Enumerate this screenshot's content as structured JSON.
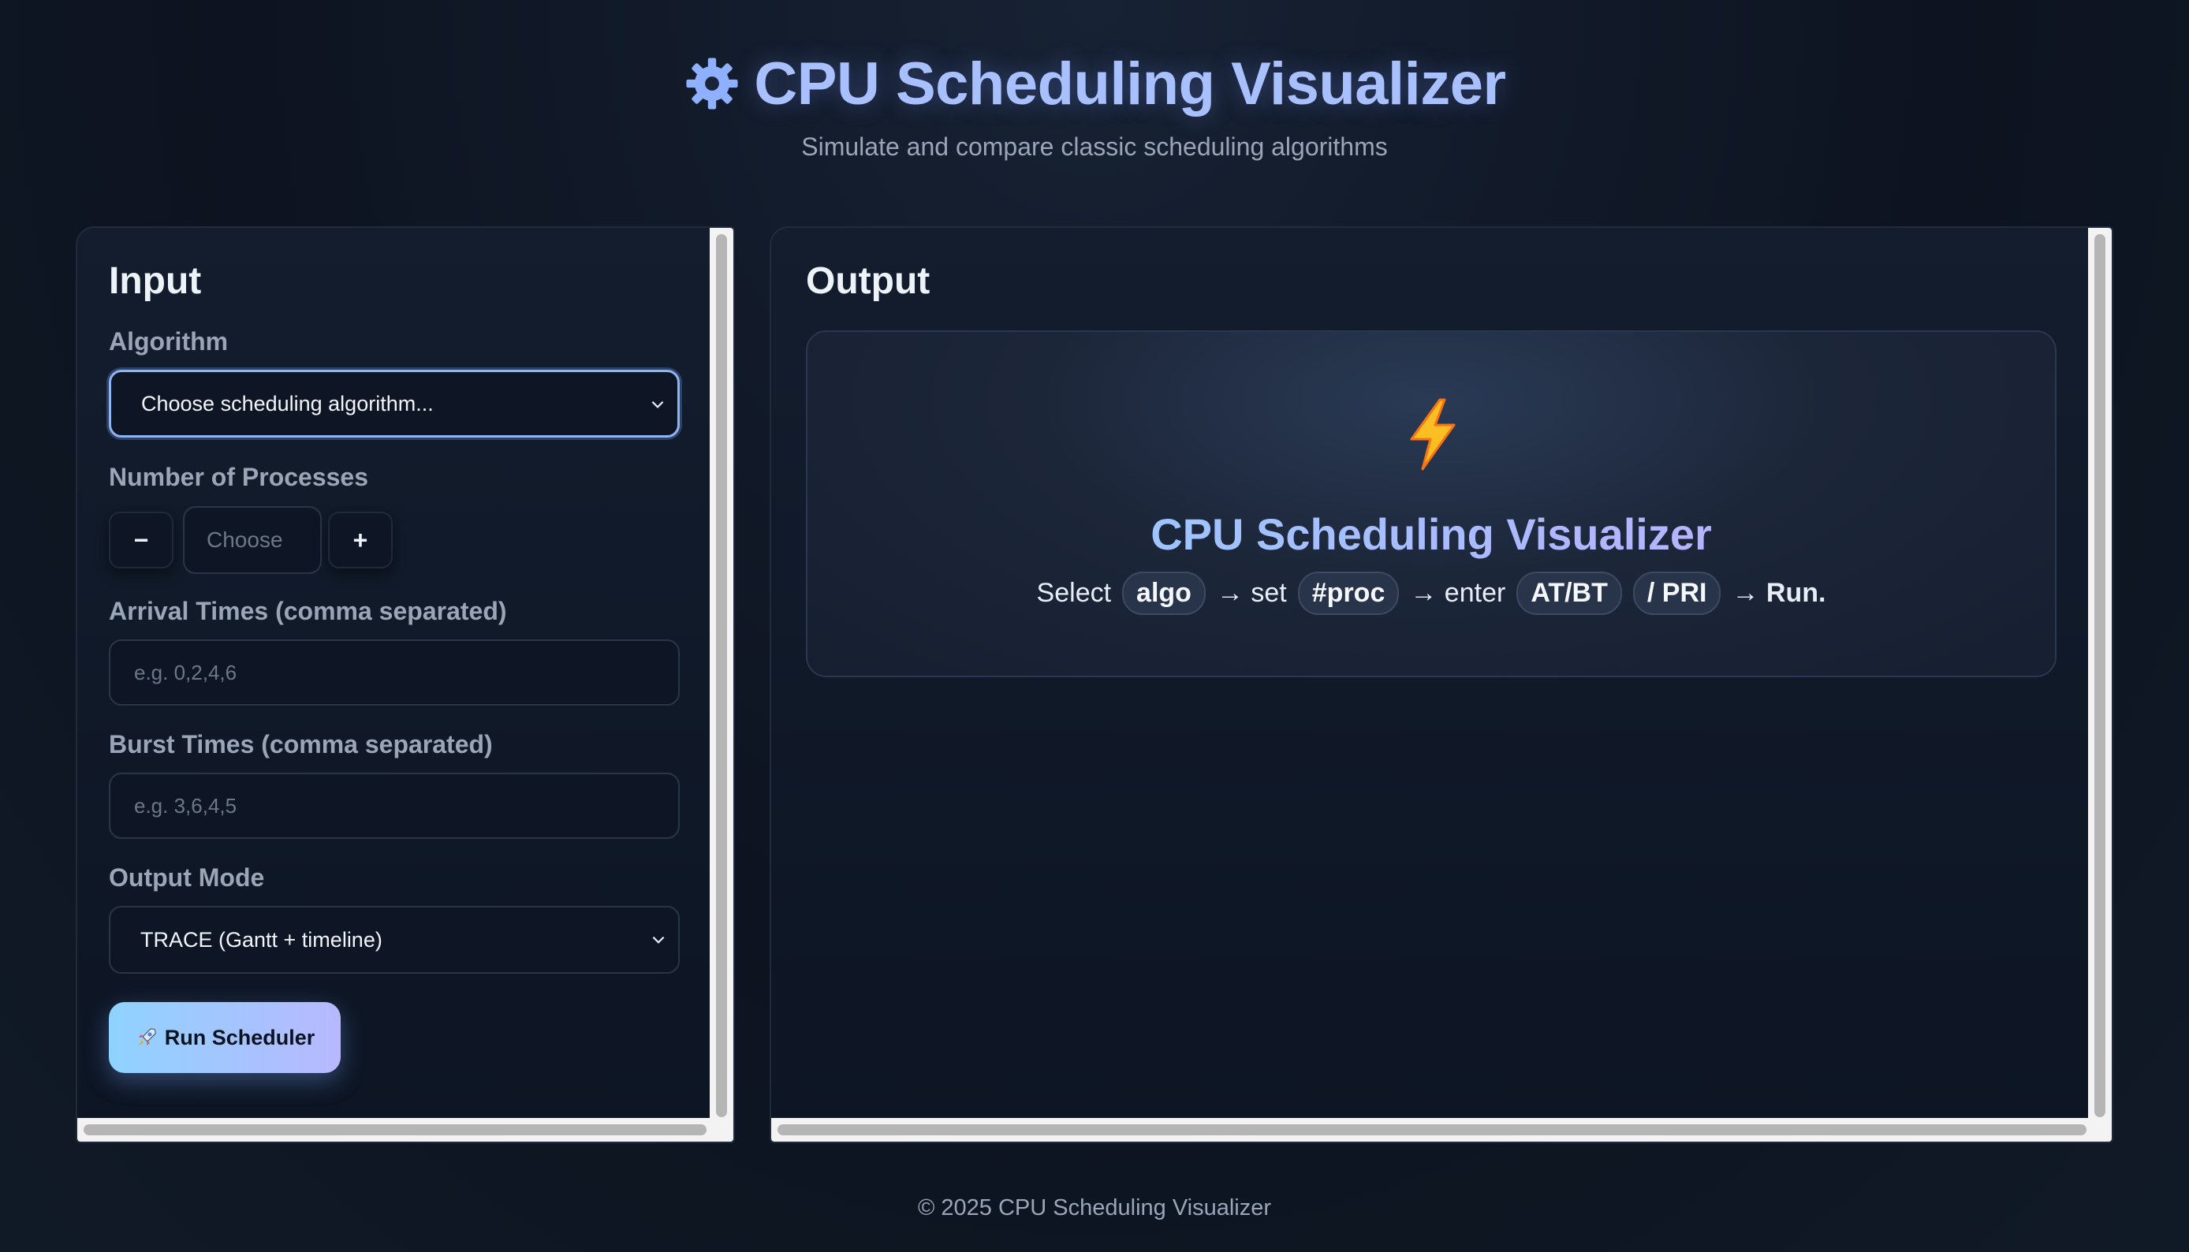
{
  "header": {
    "icon": "gear-icon",
    "title": "CPU Scheduling Visualizer",
    "subtitle": "Simulate and compare classic scheduling algorithms"
  },
  "input_panel": {
    "title": "Input",
    "algorithm": {
      "label": "Algorithm",
      "value": "Choose scheduling algorithm..."
    },
    "processes": {
      "label": "Number of Processes",
      "minus": "−",
      "placeholder": "Choose",
      "plus": "+"
    },
    "arrival": {
      "label": "Arrival Times (comma separated)",
      "placeholder": "e.g. 0,2,4,6"
    },
    "burst": {
      "label": "Burst Times (comma separated)",
      "placeholder": "e.g. 3,6,4,5"
    },
    "output_mode": {
      "label": "Output Mode",
      "value": "TRACE (Gantt + timeline)"
    },
    "run_button": "Run Scheduler"
  },
  "output_panel": {
    "title": "Output",
    "card": {
      "icon": "lightning-icon",
      "title": "CPU Scheduling Visualizer",
      "hint": {
        "select": "Select",
        "chip_algo": "algo",
        "arrow_set": "→ set",
        "chip_proc": "#proc",
        "arrow_enter": "→ enter",
        "chip_atbt": "AT/BT",
        "chip_pri": "/ PRI",
        "arrow_run": "→ Run."
      }
    }
  },
  "footer": "© 2025 CPU Scheduling Visualizer",
  "colors": {
    "accent": "#a9c0ff",
    "button_gradient_start": "#8fd3ff",
    "button_gradient_end": "#b8b8ff",
    "background": "#0d1320"
  }
}
